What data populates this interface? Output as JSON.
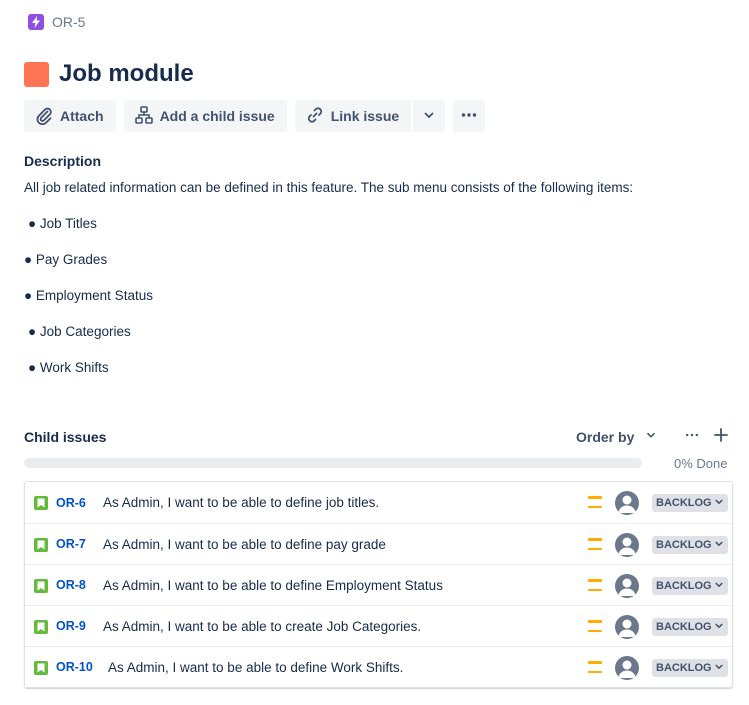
{
  "breadcrumb": {
    "key": "OR-5",
    "icon": "epic-lightning-icon",
    "icon_color": "#904ee2"
  },
  "issue": {
    "title": "Job module",
    "color": "#ff7452"
  },
  "toolbar": {
    "attach_label": "Attach",
    "add_child_label": "Add a child issue",
    "link_issue_label": "Link issue"
  },
  "description": {
    "heading": "Description",
    "text": "All job related information can be defined in this feature. The sub menu consists of the following items:",
    "bullets": [
      "● Job Titles",
      "● Pay Grades",
      "● Employment Status",
      "● Job Categories",
      "● Work Shifts"
    ]
  },
  "child_issues": {
    "heading": "Child issues",
    "order_by_label": "Order by",
    "progress_percent": 0,
    "progress_label": "0% Done",
    "items": [
      {
        "key": "OR-6",
        "summary": "As Admin, I want to be able to define job titles.",
        "status": "BACKLOG",
        "priority": "medium"
      },
      {
        "key": "OR-7",
        "summary": "As Admin, I want to be able to define pay grade",
        "status": "BACKLOG",
        "priority": "medium"
      },
      {
        "key": "OR-8",
        "summary": "As Admin, I want to be able to define Employment Status",
        "status": "BACKLOG",
        "priority": "medium"
      },
      {
        "key": "OR-9",
        "summary": "As Admin, I want to be able to create Job Categories.",
        "status": "BACKLOG",
        "priority": "medium"
      },
      {
        "key": "OR-10",
        "summary": "As Admin, I want to be able to define Work Shifts.",
        "status": "BACKLOG",
        "priority": "medium"
      }
    ]
  },
  "colors": {
    "accent": "#0052cc",
    "story": "#63ba3c",
    "priority_medium": "#ffab00",
    "progress": "#36b37e"
  }
}
